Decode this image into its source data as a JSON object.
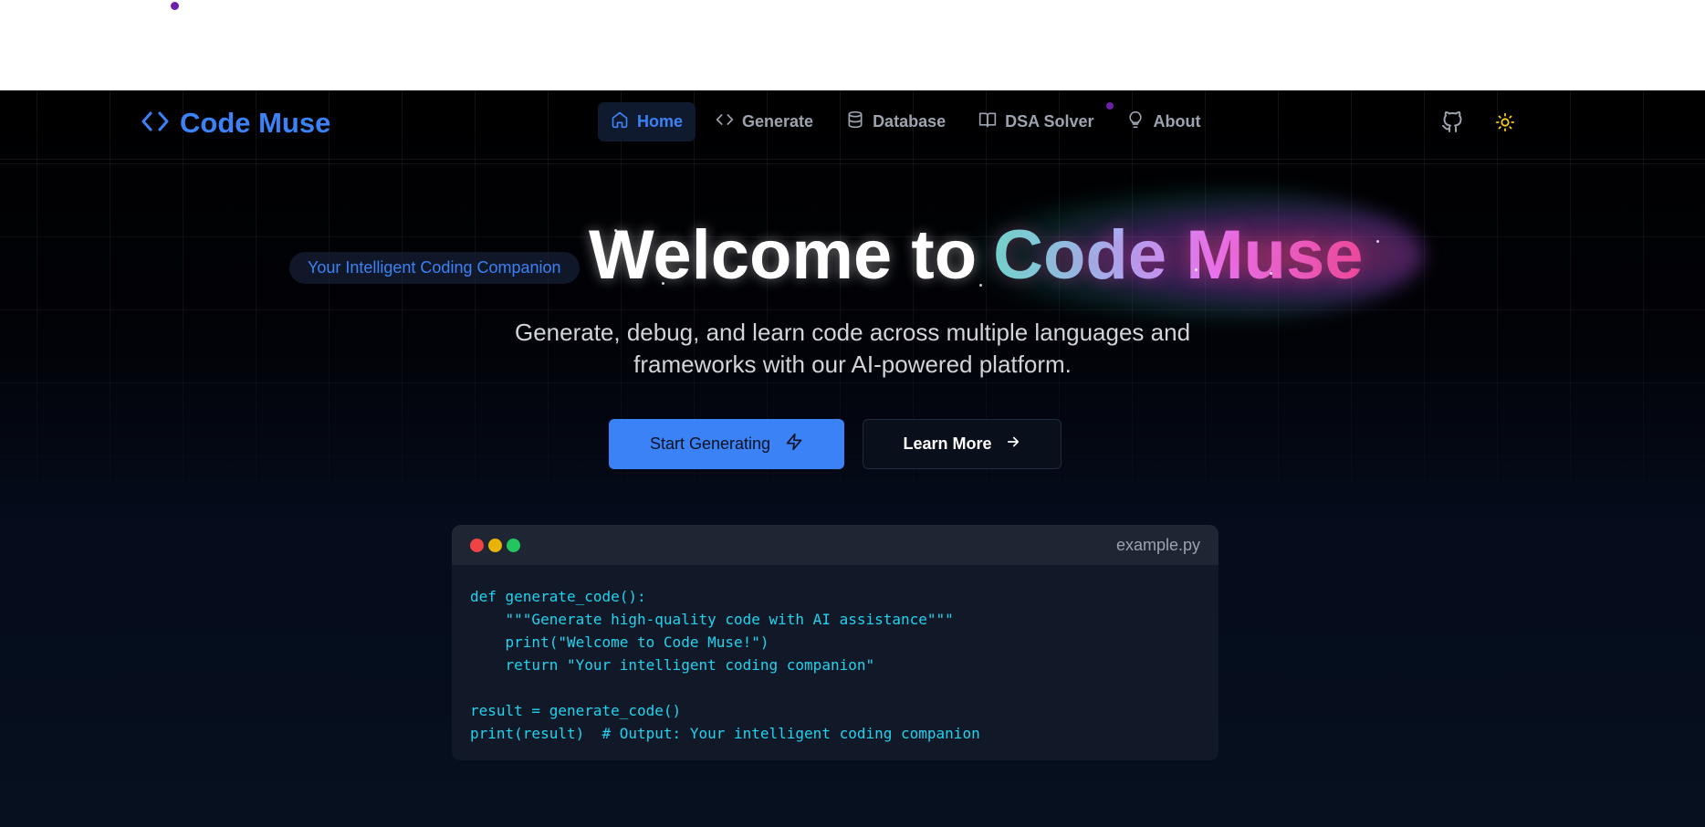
{
  "brand": {
    "name": "Code Muse",
    "icon": "code-brackets-icon"
  },
  "nav": {
    "items": [
      {
        "label": "Home",
        "icon": "home-icon",
        "active": true
      },
      {
        "label": "Generate",
        "icon": "code-icon",
        "active": false
      },
      {
        "label": "Database",
        "icon": "database-icon",
        "active": false
      },
      {
        "label": "DSA Solver",
        "icon": "book-open-icon",
        "active": false
      },
      {
        "label": "About",
        "icon": "lightbulb-icon",
        "active": false
      }
    ],
    "right": [
      {
        "icon": "github-icon"
      },
      {
        "icon": "sun-icon"
      }
    ]
  },
  "hero": {
    "badge": "Your Intelligent Coding Companion",
    "title_prefix": "Welcome to",
    "title_accent": "Code Muse",
    "subtitle_line1": "Generate, debug, and learn code across multiple languages and",
    "subtitle_line2": "frameworks with our AI-powered platform.",
    "primary_cta": "Start Generating",
    "primary_icon": "zap-icon",
    "secondary_cta": "Learn More",
    "secondary_icon": "arrow-right-icon"
  },
  "code_card": {
    "filename": "example.py",
    "code": "def generate_code():\n    \"\"\"Generate high-quality code with AI assistance\"\"\"\n    print(\"Welcome to Code Muse!\")\n    return \"Your intelligent coding companion\"\n\nresult = generate_code()\nprint(result)  # Output: Your intelligent coding companion"
  },
  "colors": {
    "accent": "#3b82f6",
    "code_text": "#22d3ee",
    "window_red": "#ef4444",
    "window_yellow": "#eab308",
    "window_green": "#22c55e",
    "sun": "#facc15"
  }
}
